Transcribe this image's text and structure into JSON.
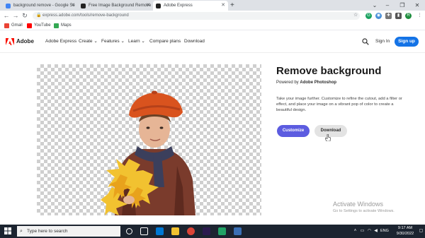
{
  "browser": {
    "tabs": [
      {
        "title": "background remove - Google Se",
        "favicon_color": "#4285f4",
        "active": false
      },
      {
        "title": "Free Image Background Remove",
        "favicon_color": "#222222",
        "active": false
      },
      {
        "title": "Adobe Express",
        "favicon_color": "#222222",
        "active": true
      }
    ],
    "new_tab_label": "+",
    "url": "express.adobe.com/tools/remove-background",
    "bookmarks": [
      {
        "label": "Gmail",
        "color": "#ea4335"
      },
      {
        "label": "YouTube",
        "color": "#ff0000"
      },
      {
        "label": "Maps",
        "color": "#34a853"
      }
    ],
    "profile_initial": "R"
  },
  "site": {
    "logo_text": "Adobe",
    "brand_color": "#fa0f00",
    "nav": [
      "Adobe Express",
      "Create",
      "Features",
      "Learn",
      "Compare plans",
      "Download"
    ],
    "signin": "Sign In",
    "signup": "Sign up"
  },
  "main": {
    "title": "Remove background",
    "powered_prefix": "Powered by",
    "powered_brand": "Adobe Photoshop",
    "description": "Take your image further. Customize to refine the cutout, add a filter or effect, and place your image on a vibrant pop of color to create a beautiful design.",
    "customize_label": "Customize",
    "download_label": "Download",
    "customize_color": "#5c5ce0"
  },
  "watermark": {
    "title": "Activate Windows",
    "subtitle": "Go to Settings to activate Windows."
  },
  "taskbar": {
    "search_placeholder": "Type here to search",
    "language": "ENG",
    "time": "9:17 AM",
    "date": "9/30/2022"
  }
}
